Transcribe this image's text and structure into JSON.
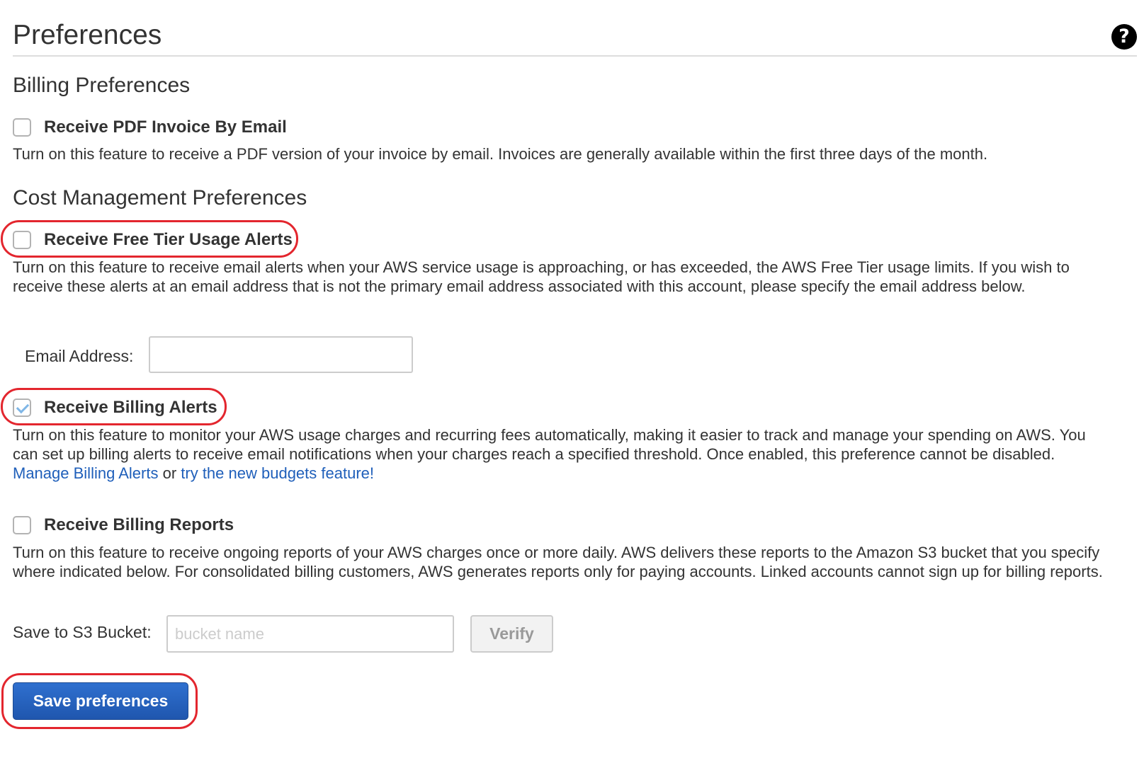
{
  "page": {
    "title": "Preferences",
    "help_icon": "question-circle-icon"
  },
  "billing_preferences": {
    "heading": "Billing Preferences",
    "pdf_invoice": {
      "label": "Receive PDF Invoice By Email",
      "checked": false,
      "description": "Turn on this feature to receive a PDF version of your invoice by email. Invoices are generally available within the first three days of the month."
    }
  },
  "cost_management": {
    "heading": "Cost Management Preferences",
    "free_tier": {
      "label": "Receive Free Tier Usage Alerts",
      "checked": false,
      "description": "Turn on this feature to receive email alerts when your AWS service usage is approaching, or has exceeded, the AWS Free Tier usage limits. If you wish to receive these alerts at an email address that is not the primary email address associated with this account, please specify the email address below.",
      "email_label": "Email Address:",
      "email_value": "",
      "email_placeholder": ""
    },
    "billing_alerts": {
      "label": "Receive Billing Alerts",
      "checked": true,
      "description_text": "Turn on this feature to monitor your AWS usage charges and recurring fees automatically, making it easier to track and manage your spending on AWS. You can set up billing alerts to receive email notifications when your charges reach a specified threshold. Once enabled, this preference cannot be disabled.",
      "manage_link": "Manage Billing Alerts",
      "or_text": "or",
      "budgets_link": "try the new budgets feature!"
    },
    "billing_reports": {
      "label": "Receive Billing Reports",
      "checked": false,
      "description": "Turn on this feature to receive ongoing reports of your AWS charges once or more daily. AWS delivers these reports to the Amazon S3 bucket that you specify where indicated below. For consolidated billing customers, AWS generates reports only for paying accounts. Linked accounts cannot sign up for billing reports.",
      "bucket_label": "Save to S3 Bucket:",
      "bucket_value": "",
      "bucket_placeholder": "bucket name",
      "verify_label": "Verify"
    }
  },
  "actions": {
    "save_label": "Save preferences"
  },
  "colors": {
    "link": "#1f5fba",
    "highlight": "#e3262e",
    "primary_button": "#1f56ae"
  }
}
